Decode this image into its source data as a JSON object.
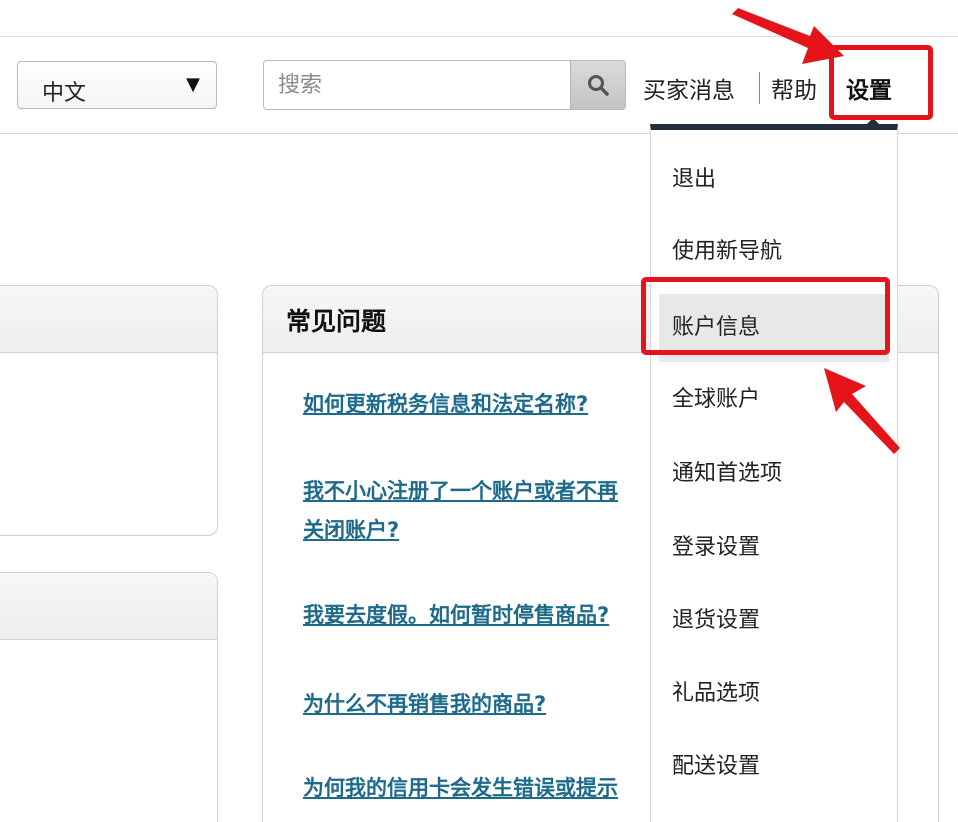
{
  "header": {
    "language": {
      "value": "中文"
    },
    "search": {
      "placeholder": "搜索"
    },
    "nav": {
      "messages": "买家消息",
      "help": "帮助",
      "settings": "设置"
    }
  },
  "faq": {
    "title": "常见问题",
    "links": [
      "如何更新税务信息和法定名称?",
      "我不小心注册了一个账户或者不再",
      "关闭账户?",
      "我要去度假。如何暂时停售商品?",
      "为什么不再销售我的商品?",
      "为何我的信用卡会发生错误或提示"
    ]
  },
  "settings_menu": {
    "items": [
      "退出",
      "使用新导航",
      "账户信息",
      "全球账户",
      "通知首选项",
      "登录设置",
      "退货设置",
      "礼品选项",
      "配送设置"
    ],
    "active_index": 2
  },
  "annotations": {
    "color": "#e5141a"
  },
  "colors": {
    "link": "#1d6a8a",
    "menu_top_bar": "#232f3e"
  },
  "icons": {
    "search": "search-icon",
    "language_dropdown": "caret-down-icon"
  }
}
